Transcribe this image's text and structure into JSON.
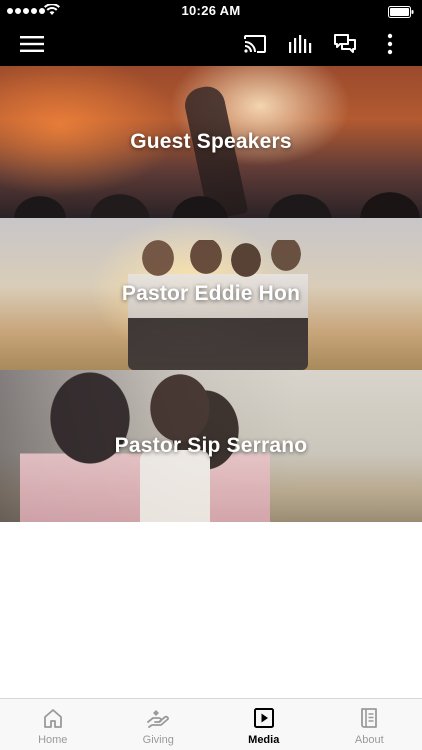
{
  "status_bar": {
    "time": "10:26 AM"
  },
  "app_bar": {
    "icons": [
      "menu-icon",
      "cast-icon",
      "audio-bars-icon",
      "chat-icon",
      "more-vertical-icon"
    ]
  },
  "media_cards": [
    {
      "title": "Guest Speakers"
    },
    {
      "title": "Pastor Eddie Hon"
    },
    {
      "title": "Pastor Sip Serrano"
    }
  ],
  "tab_bar": {
    "tabs": [
      {
        "label": "Home",
        "icon": "home-icon",
        "active": false
      },
      {
        "label": "Giving",
        "icon": "giving-hand-icon",
        "active": false
      },
      {
        "label": "Media",
        "icon": "media-play-icon",
        "active": true
      },
      {
        "label": "About",
        "icon": "about-book-icon",
        "active": false
      }
    ]
  },
  "colors": {
    "bar": "#000000",
    "active_tab": "#000000",
    "inactive_tab": "#9a9a9a",
    "tab_bar_bg": "#f8f8f8"
  }
}
